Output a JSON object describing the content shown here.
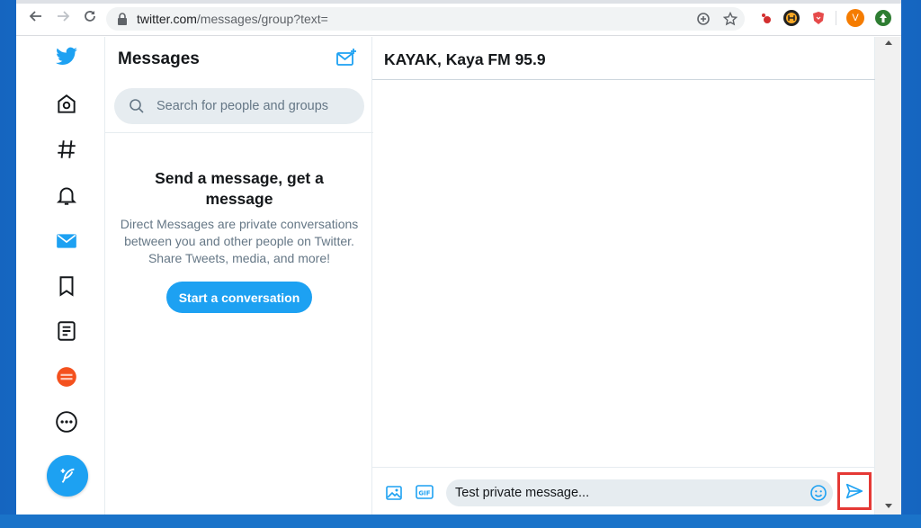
{
  "browser": {
    "url_host": "twitter.com",
    "url_path": "/messages/group?text=",
    "avatar_letter": "V"
  },
  "rail": {
    "items": [
      "twitter-logo",
      "home",
      "explore",
      "notifications",
      "messages",
      "bookmarks",
      "lists",
      "profile",
      "more"
    ]
  },
  "messages": {
    "title": "Messages",
    "search_placeholder": "Search for people and groups",
    "empty_title": "Send a message, get a message",
    "empty_body": "Direct Messages are private conversations between you and other people on Twitter. Share Tweets, media, and more!",
    "start_button": "Start a conversation"
  },
  "conversation": {
    "title": "KAYAK, Kaya FM 95.9",
    "composer_value": "Test private message..."
  },
  "colors": {
    "accent": "#1da1f2",
    "highlight": "#e53935"
  }
}
